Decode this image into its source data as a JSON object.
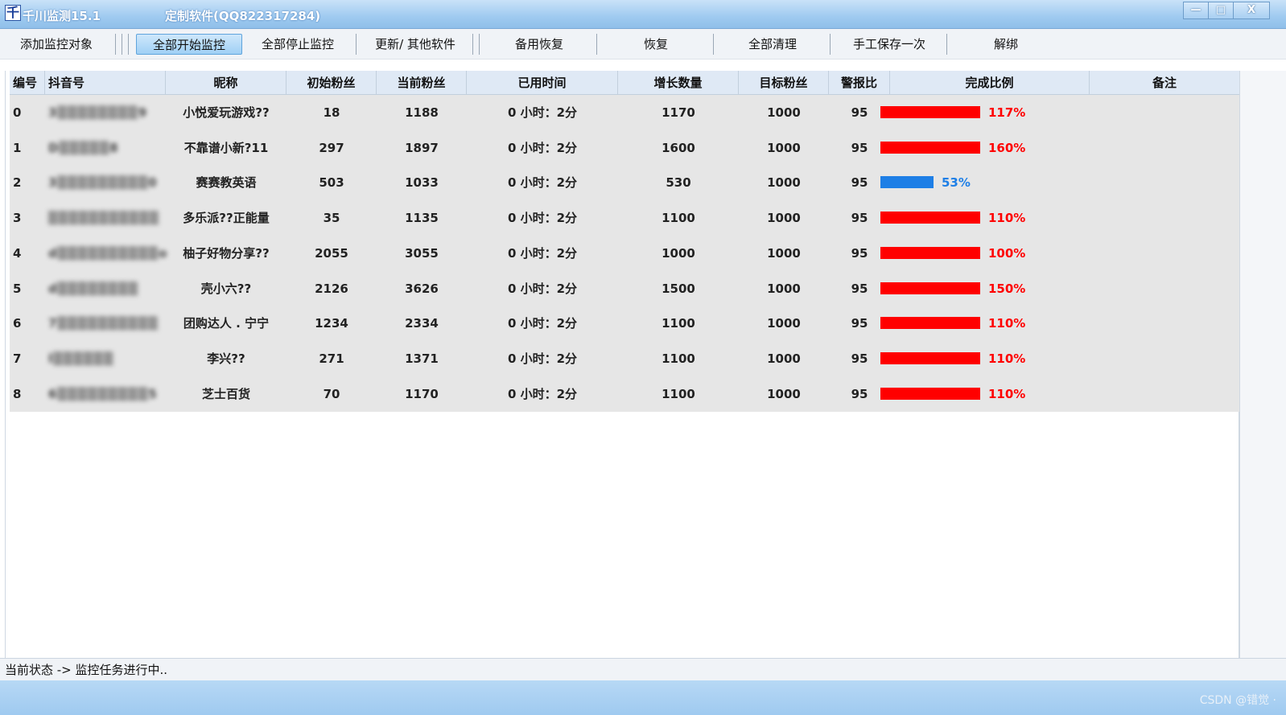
{
  "window": {
    "icon_glyph": "千",
    "title": "千川监测15.1",
    "subtitle": "定制软件(QQ822317284)",
    "controls": {
      "minimize": "—",
      "maximize": "□",
      "close": "X"
    }
  },
  "toolbar": {
    "buttons": [
      {
        "label": "添加监控对象"
      },
      {
        "label": "全部开始监控",
        "active": true
      },
      {
        "label": "全部停止监控"
      },
      {
        "label": "更新/ 其他软件"
      },
      {
        "label": "备用恢复"
      },
      {
        "label": "恢复"
      },
      {
        "label": "全部清理"
      },
      {
        "label": "手工保存一次"
      },
      {
        "label": "解绑"
      }
    ]
  },
  "table": {
    "headers": [
      "编号",
      "抖音号",
      "昵称",
      "初始粉丝",
      "当前粉丝",
      "已用时间",
      "增长数量",
      "目标粉丝",
      "警报比",
      "完成比例",
      "备注"
    ],
    "rows": [
      {
        "id": "0",
        "douyin": "3▒▒▒▒▒▒▒▒9",
        "nickname": "小悦爱玩游戏??",
        "initial": "18",
        "current": "1188",
        "elapsed": "0 小时：2分",
        "growth": "1170",
        "target": "1000",
        "alert": "95",
        "progress": 117,
        "progress_label": "117%",
        "progress_color": "#ff0000",
        "note": ""
      },
      {
        "id": "1",
        "douyin": "D▒▒▒▒▒8",
        "nickname": "不靠谱小新?11",
        "initial": "297",
        "current": "1897",
        "elapsed": "0 小时：2分",
        "growth": "1600",
        "target": "1000",
        "alert": "95",
        "progress": 160,
        "progress_label": "160%",
        "progress_color": "#ff0000",
        "note": ""
      },
      {
        "id": "2",
        "douyin": "3▒▒▒▒▒▒▒▒▒0",
        "nickname": "赛赛教英语",
        "initial": "503",
        "current": "1033",
        "elapsed": "0 小时：2分",
        "growth": "530",
        "target": "1000",
        "alert": "95",
        "progress": 53,
        "progress_label": "53%",
        "progress_color": "#1e7fe6",
        "note": ""
      },
      {
        "id": "3",
        "douyin": "▒▒▒▒▒▒▒▒▒▒▒",
        "nickname": "多乐派??正能量",
        "initial": "35",
        "current": "1135",
        "elapsed": "0 小时：2分",
        "growth": "1100",
        "target": "1000",
        "alert": "95",
        "progress": 110,
        "progress_label": "110%",
        "progress_color": "#ff0000",
        "note": ""
      },
      {
        "id": "4",
        "douyin": "d▒▒▒▒▒▒▒▒▒▒o",
        "nickname": "柚子好物分享??",
        "initial": "2055",
        "current": "3055",
        "elapsed": "0 小时：2分",
        "growth": "1000",
        "target": "1000",
        "alert": "95",
        "progress": 100,
        "progress_label": "100%",
        "progress_color": "#ff0000",
        "note": ""
      },
      {
        "id": "5",
        "douyin": "d▒▒▒▒▒▒▒▒",
        "nickname": "壳小六??",
        "initial": "2126",
        "current": "3626",
        "elapsed": "0 小时：2分",
        "growth": "1500",
        "target": "1000",
        "alert": "95",
        "progress": 150,
        "progress_label": "150%",
        "progress_color": "#ff0000",
        "note": ""
      },
      {
        "id": "6",
        "douyin": "7▒▒▒▒▒▒▒▒▒▒",
        "nickname": "团购达人 . 宁宁",
        "initial": "1234",
        "current": "2334",
        "elapsed": "0 小时：2分",
        "growth": "1100",
        "target": "1000",
        "alert": "95",
        "progress": 110,
        "progress_label": "110%",
        "progress_color": "#ff0000",
        "note": ""
      },
      {
        "id": "7",
        "douyin": "l▒▒▒▒▒▒",
        "nickname": "李兴??",
        "initial": "271",
        "current": "1371",
        "elapsed": "0 小时：2分",
        "growth": "1100",
        "target": "1000",
        "alert": "95",
        "progress": 110,
        "progress_label": "110%",
        "progress_color": "#ff0000",
        "note": ""
      },
      {
        "id": "8",
        "douyin": "6▒▒▒▒▒▒▒▒▒5",
        "nickname": "芝士百货",
        "initial": "70",
        "current": "1170",
        "elapsed": "0 小时：2分",
        "growth": "1100",
        "target": "1000",
        "alert": "95",
        "progress": 110,
        "progress_label": "110%",
        "progress_color": "#ff0000",
        "note": ""
      }
    ]
  },
  "status": {
    "text": "当前状态 -> 监控任务进行中.."
  },
  "watermark": "CSDN @错觉 ·"
}
